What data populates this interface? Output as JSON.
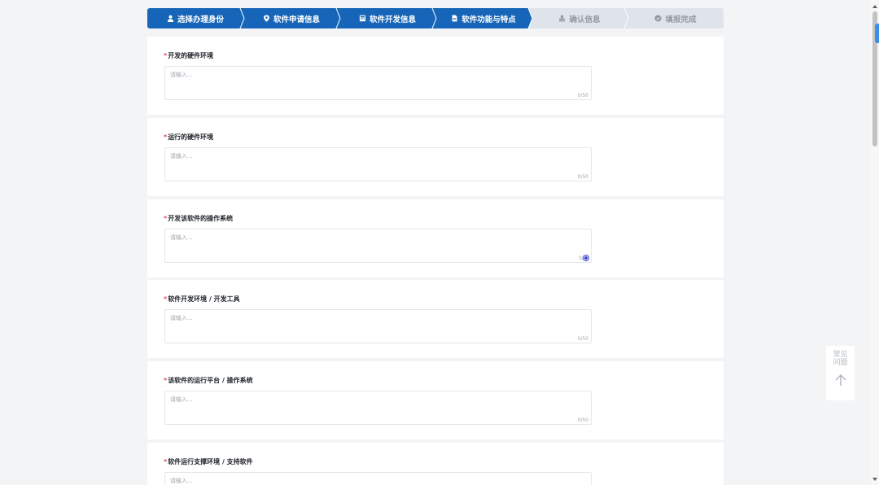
{
  "steps": [
    {
      "label": "选择办理身份",
      "icon": "user-icon",
      "active": true
    },
    {
      "label": "软件申请信息",
      "icon": "location-pin-icon",
      "active": true
    },
    {
      "label": "软件开发信息",
      "icon": "calculator-icon",
      "active": true
    },
    {
      "label": "软件功能与特点",
      "icon": "document-icon",
      "active": true
    },
    {
      "label": "确认信息",
      "icon": "stamp-icon",
      "active": false
    },
    {
      "label": "填报完成",
      "icon": "check-circle-icon",
      "active": false
    }
  ],
  "fields": [
    {
      "label": "开发的硬件环境",
      "required": true,
      "placeholder": "请输入...",
      "counter": "0/50"
    },
    {
      "label": "运行的硬件环境",
      "required": true,
      "placeholder": "请输入...",
      "counter": "0/50"
    },
    {
      "label": "开发该软件的操作系统",
      "required": true,
      "placeholder": "请输入...",
      "counter": "0/"
    },
    {
      "label": "软件开发环境 / 开发工具",
      "required": true,
      "placeholder": "请输入...",
      "counter": "0/50"
    },
    {
      "label": "该软件的运行平台 / 操作系统",
      "required": true,
      "placeholder": "请输入...",
      "counter": "0/50"
    },
    {
      "label": "软件运行支撑环境 / 支持软件",
      "required": true,
      "placeholder": "请输入...",
      "counter": ""
    }
  ],
  "required_mark": "*",
  "faq": {
    "label": "常见问题",
    "icon": "arrow-up-icon"
  },
  "colors": {
    "active_step": "#1665b9",
    "inactive_step": "#dfe3ea",
    "required": "#e34d59"
  }
}
